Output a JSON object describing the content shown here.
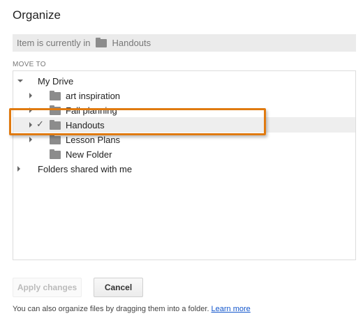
{
  "dialog": {
    "title": "Organize"
  },
  "current": {
    "prefix": "Item is currently in",
    "folder": "Handouts"
  },
  "section_label": "MOVE TO",
  "tree": {
    "root": "My Drive",
    "items": [
      {
        "label": "art inspiration",
        "has_children": true,
        "selected": false
      },
      {
        "label": "Fall planning",
        "has_children": true,
        "selected": false
      },
      {
        "label": "Handouts",
        "has_children": true,
        "selected": true
      },
      {
        "label": "Lesson Plans",
        "has_children": true,
        "selected": false
      },
      {
        "label": "New Folder",
        "has_children": false,
        "selected": false
      }
    ],
    "shared": "Folders shared with me"
  },
  "buttons": {
    "apply": "Apply changes",
    "cancel": "Cancel"
  },
  "footer": {
    "text": "You can also organize files by dragging them into a folder.",
    "link": "Learn more"
  },
  "colors": {
    "highlight_border": "#e07a10",
    "link": "#1155cc",
    "folder_icon": "#8c8c8c"
  }
}
